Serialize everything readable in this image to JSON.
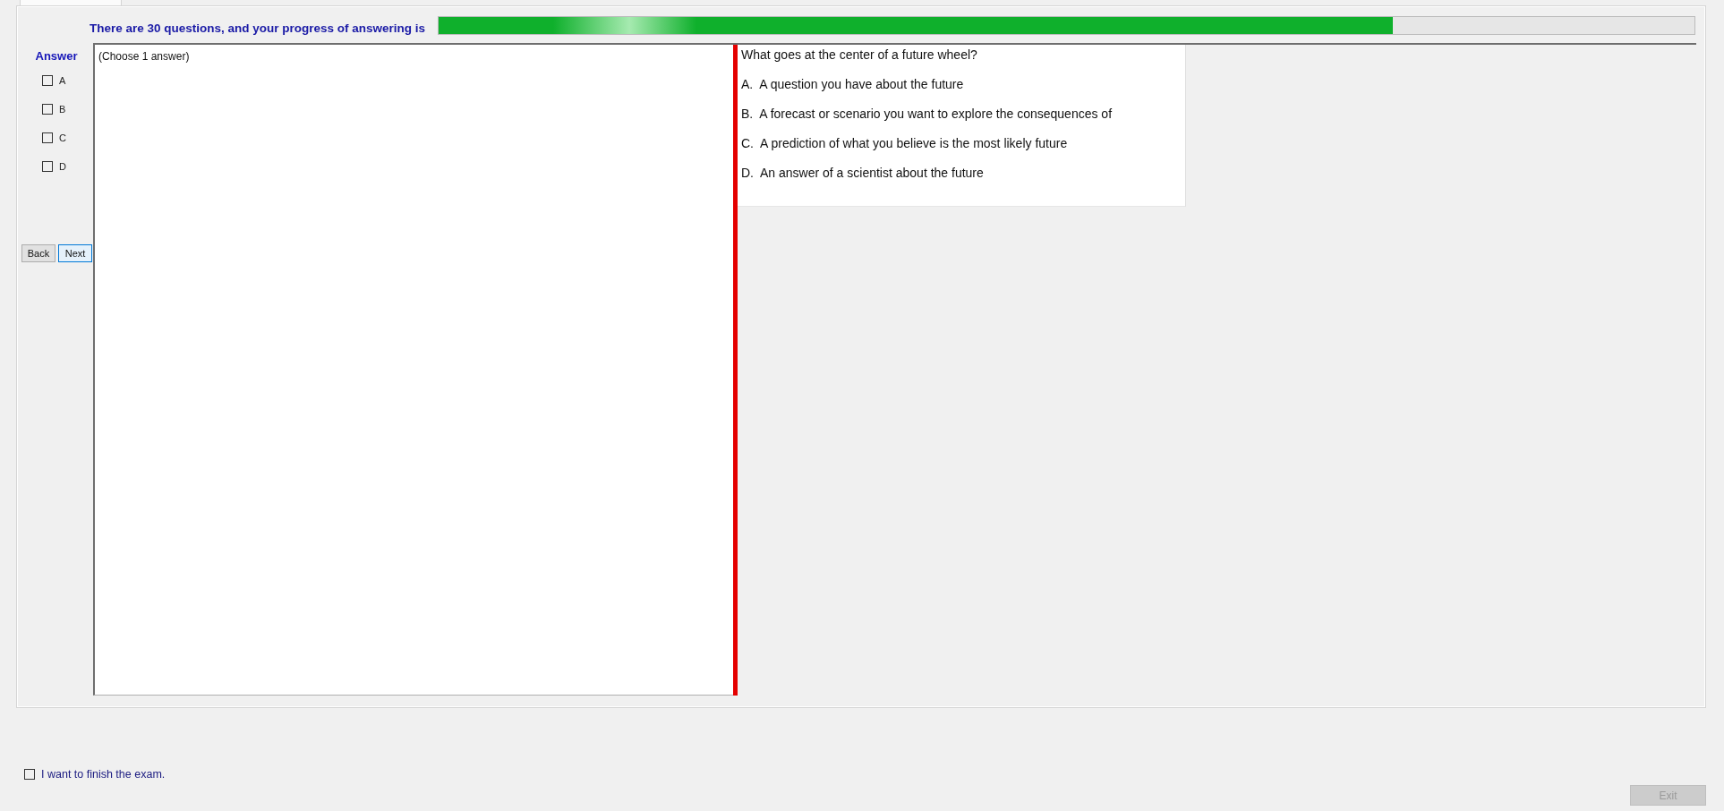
{
  "header": {
    "text": "There are 30 questions, and your progress of answering is",
    "progress": {
      "level": 0.76
    }
  },
  "answer_panel": {
    "title": "Answer",
    "options": [
      {
        "label": "A",
        "checked": false
      },
      {
        "label": "B",
        "checked": false
      },
      {
        "label": "C",
        "checked": false
      },
      {
        "label": "D",
        "checked": false
      }
    ],
    "buttons": [
      {
        "label": "Back",
        "focused": false
      },
      {
        "label": "Next",
        "focused": true
      }
    ]
  },
  "instruction": "(Choose 1 answer)",
  "question": {
    "text": "What goes at the center of a future wheel?",
    "options": [
      "A.  A question you have about the future",
      "B.  A forecast or scenario you want to explore the consequences of",
      "C.  A prediction of what you believe is the most likely future",
      "D.  An answer of a scientist about the future"
    ]
  },
  "finish": {
    "label": "I want to finish the exam.",
    "checked": false
  },
  "exit_button": {
    "label": "Exit",
    "disabled": true
  }
}
